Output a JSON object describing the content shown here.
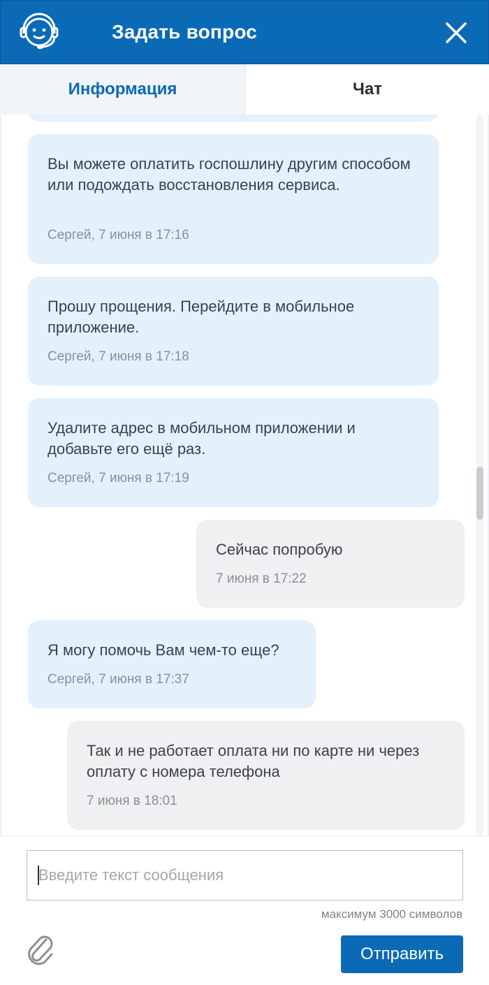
{
  "header": {
    "title": "Задать вопрос",
    "icons": {
      "support": "support-agent-icon",
      "close": "close-icon"
    },
    "colors": {
      "brand": "#0a6ab6"
    }
  },
  "tabs": [
    {
      "label": "Информация",
      "active": false
    },
    {
      "label": "Чат",
      "active": true
    }
  ],
  "messages": [
    {
      "from": "operator",
      "text": "Вы можете оплатить госпошлину другим способом или подождать восстановления сервиса.",
      "meta": "Сергей, 7 июня в 17:16"
    },
    {
      "from": "operator",
      "text": "Прошу прощения. Перейдите в мобильное приложение.",
      "meta": "Сергей, 7 июня в 17:18"
    },
    {
      "from": "operator",
      "text": "Удалите адрес в мобильном приложении и добавьте его ещё раз.",
      "meta": "Сергей, 7 июня в 17:19"
    },
    {
      "from": "user",
      "text": "Сейчас попробую",
      "meta": "7 июня в 17:22"
    },
    {
      "from": "operator",
      "text": "Я могу помочь Вам чем-то еще?",
      "meta": "Сергей, 7 июня в 17:37"
    },
    {
      "from": "user",
      "text": "Так и не работает оплата ни по карте ни через оплату с номера телефона",
      "meta": "7 июня в 18:01"
    }
  ],
  "composer": {
    "placeholder": "Введите текст сообщения",
    "value": "",
    "limit_text": "максимум 3000 символов",
    "send_label": "Отправить",
    "attach_icon": "paperclip-icon"
  }
}
